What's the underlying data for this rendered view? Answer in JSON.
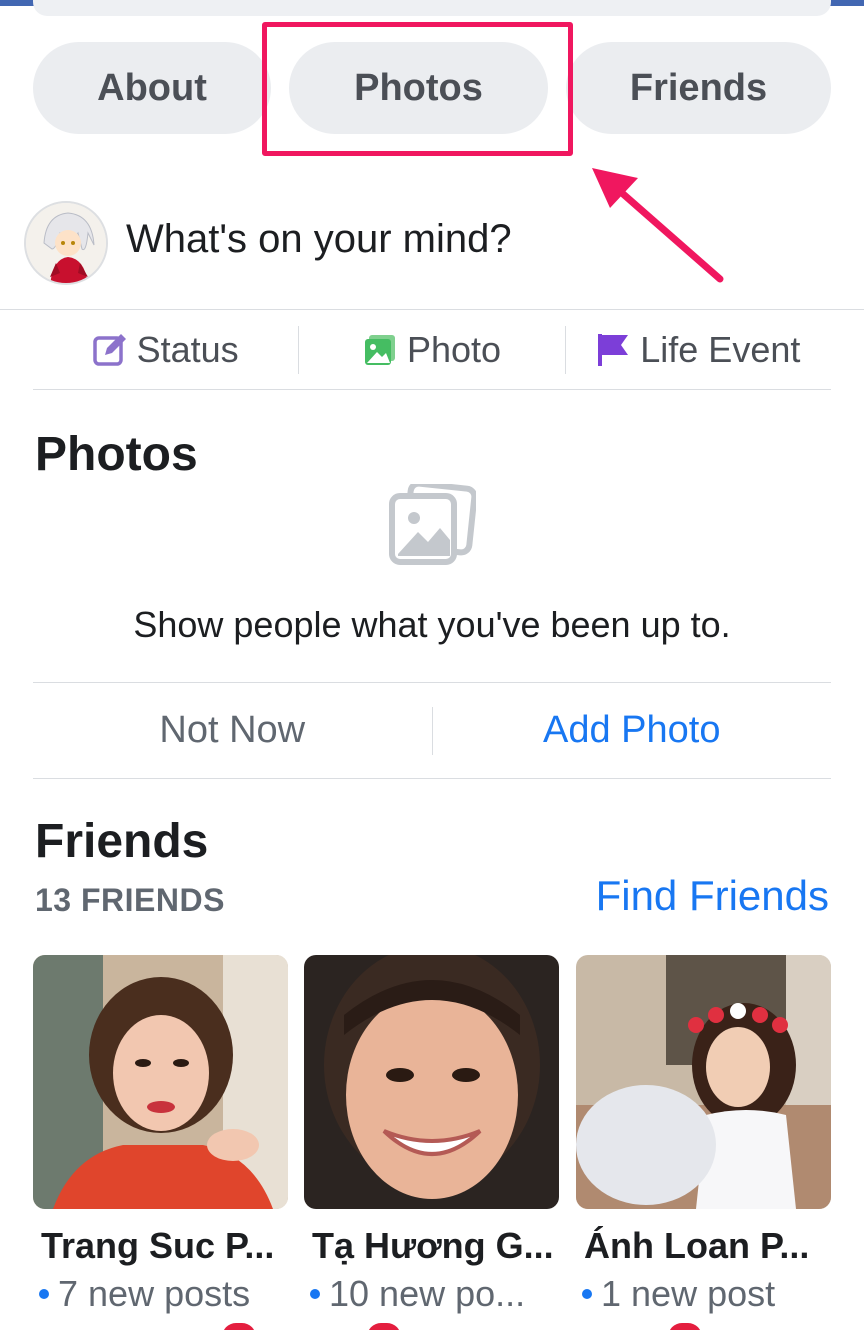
{
  "profile_tabs": [
    {
      "label": "About"
    },
    {
      "label": "Photos"
    },
    {
      "label": "Friends"
    }
  ],
  "composer": {
    "prompt": "What's on your mind?"
  },
  "composer_actions": [
    {
      "label": "Status",
      "icon": "edit-icon",
      "color": "#8c72cb"
    },
    {
      "label": "Photo",
      "icon": "photo-icon",
      "color": "#45bd62"
    },
    {
      "label": "Life Event",
      "icon": "flag-icon",
      "color": "#7c3ed8"
    }
  ],
  "photos_section": {
    "title": "Photos",
    "empty_icon": "photo-gallery-icon",
    "empty_text": "Show people what you've been up to.",
    "not_now_label": "Not Now",
    "add_photo_label": "Add Photo"
  },
  "friends_section": {
    "title": "Friends",
    "count_label": "13 FRIENDS",
    "find_friends_label": "Find Friends",
    "friends": [
      {
        "name": "Trang Suc P...",
        "posts": "7 new posts"
      },
      {
        "name": "Tạ Hương G...",
        "posts": "10 new po..."
      },
      {
        "name": "Ánh Loan P...",
        "posts": "1 new post"
      }
    ]
  },
  "colors": {
    "accent_blue": "#1877f2",
    "highlight_pink": "#f0175f",
    "pill_bg": "#ebedf0"
  }
}
